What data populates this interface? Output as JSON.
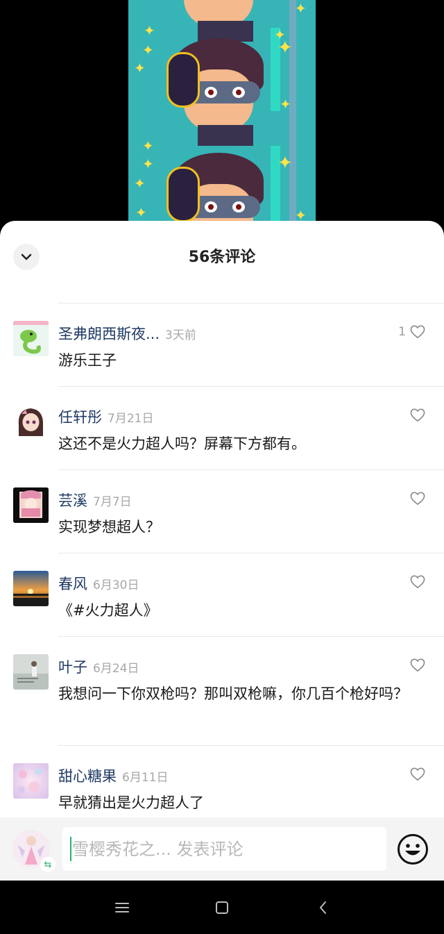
{
  "sheet": {
    "title": "56条评论"
  },
  "comments": [
    {
      "name": "圣弗朗西斯夜...",
      "time": "3天前",
      "text": "游乐王子",
      "likes": "1"
    },
    {
      "name": "任轩彤",
      "time": "7月21日",
      "text": "这还不是火力超人吗？屏幕下方都有。",
      "likes": ""
    },
    {
      "name": "芸溪",
      "time": "7月7日",
      "text": "实现梦想超人？",
      "likes": ""
    },
    {
      "name": "春风",
      "time": "6月30日",
      "text": "《#火力超人》",
      "likes": ""
    },
    {
      "name": "叶子",
      "time": "6月24日",
      "text": "我想问一下你双枪吗？那叫双枪嘛，你几百个枪好吗？",
      "likes": ""
    },
    {
      "name": "甜心糖果",
      "time": "6月11日",
      "text": "早就猜出是火力超人了",
      "likes": ""
    }
  ],
  "input": {
    "placeholder": "雪樱秀花之... 发表评论"
  },
  "colors": {
    "accent": "#21b36b",
    "username": "#1f3a63",
    "video_bg": "#37b4b6"
  }
}
